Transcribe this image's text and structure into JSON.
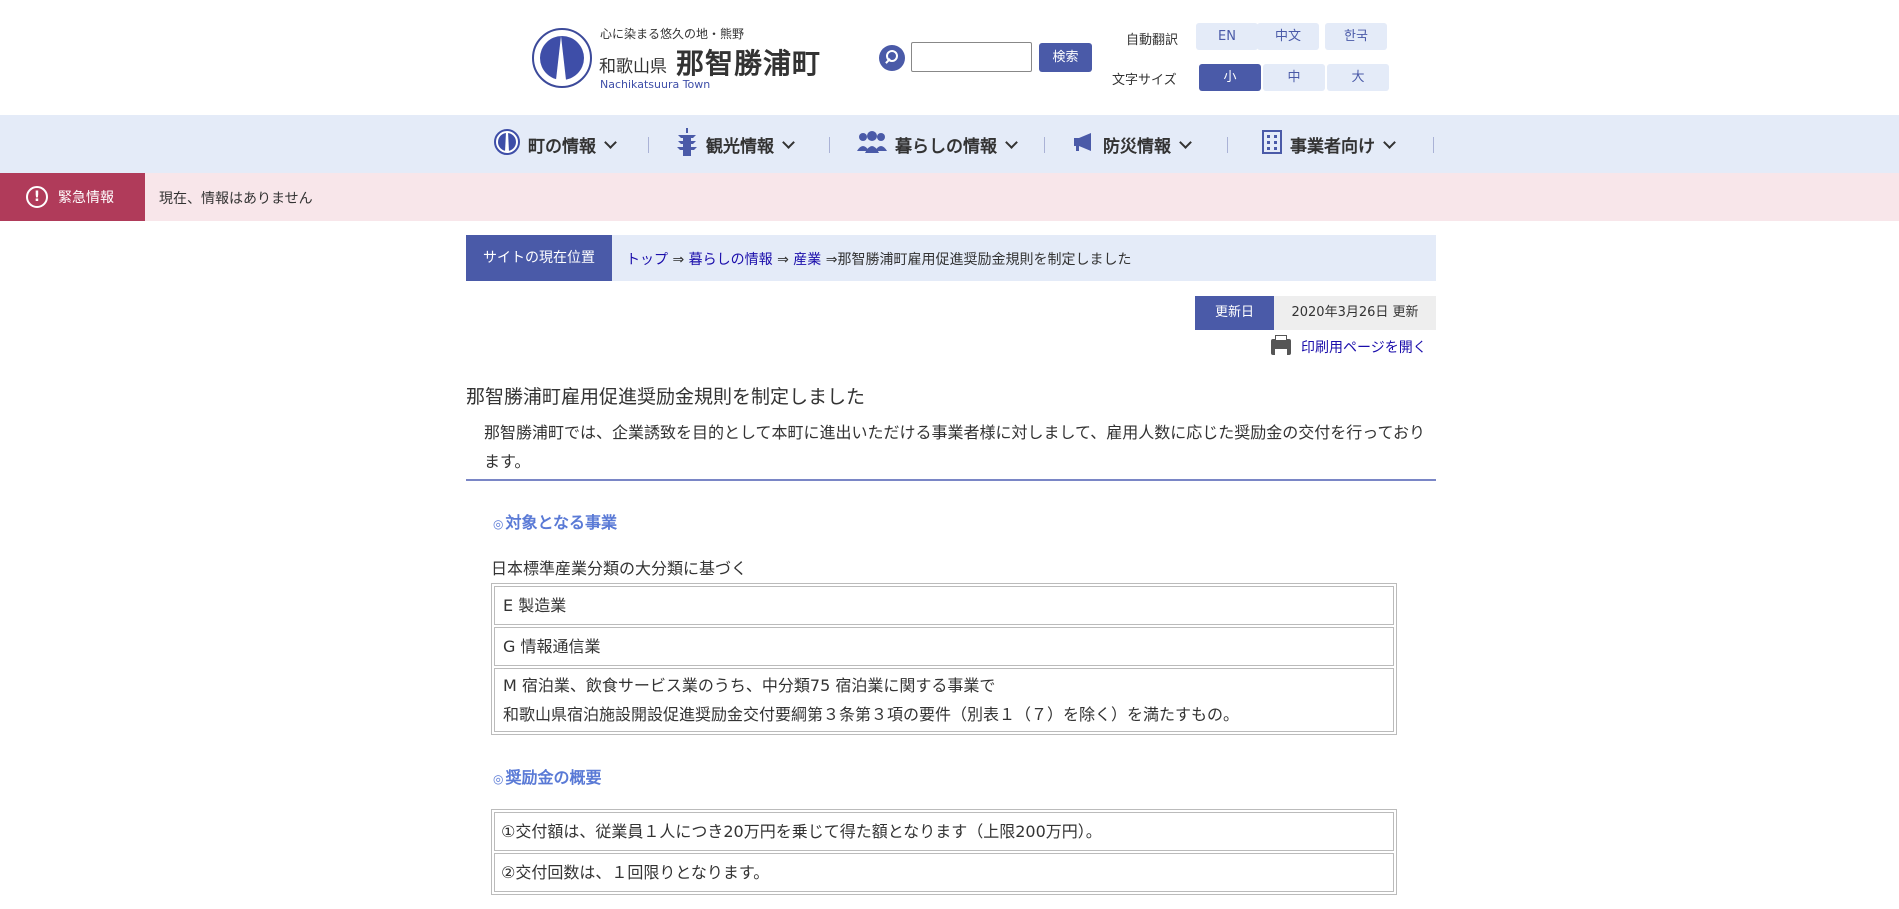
{
  "header": {
    "tagline": "心に染まる悠久の地・熊野",
    "prefecture": "和歌山県",
    "town_name": "那智勝浦町",
    "town_en": "Nachikatsuura Town",
    "search_button": "検索",
    "search_placeholder": "",
    "translate_label": "自動翻訳",
    "languages": [
      "EN",
      "中文",
      "한국"
    ],
    "font_size_label": "文字サイズ",
    "font_sizes": [
      "小",
      "中",
      "大"
    ],
    "font_size_selected": "小"
  },
  "nav": {
    "items": [
      {
        "label": "町の情報",
        "icon": "town-icon"
      },
      {
        "label": "観光情報",
        "icon": "pagoda-icon"
      },
      {
        "label": "暮らしの情報",
        "icon": "people-icon"
      },
      {
        "label": "防災情報",
        "icon": "megaphone-icon"
      },
      {
        "label": "事業者向け",
        "icon": "building-icon"
      }
    ]
  },
  "emergency": {
    "label": "緊急情報",
    "text": "現在、情報はありません"
  },
  "breadcrumb": {
    "label": "サイトの現在位置",
    "links": [
      "トップ",
      "暮らしの情報",
      "産業"
    ],
    "separator": "⇒",
    "current": "那智勝浦町雇用促進奨励金規則を制定しました"
  },
  "updated": {
    "label": "更新日",
    "value": "2020年3月26日 更新"
  },
  "print_link": "印刷用ページを開く",
  "content": {
    "title": "那智勝浦町雇用促進奨励金規則を制定しました",
    "lead": "那智勝浦町では、企業誘致を目的として本町に進出いただける事業者様に対しまして、雇用人数に応じた奨励金の交付を行っております。",
    "section1_mark": "◎",
    "section1_heading": "対象となる事業",
    "section1_basis": "日本標準産業分類の大分類に基づく",
    "section1_rows": [
      "E 製造業",
      "G 情報通信業",
      "M 宿泊業、飲食サービス業のうち、中分類75 宿泊業に関する事業で",
      "和歌山県宿泊施設開設促進奨励金交付要綱第３条第３項の要件（別表１（７）を除く）を満たすもの。"
    ],
    "section2_mark": "◎",
    "section2_heading": "奨励金の概要",
    "section2_rows": [
      "①交付額は、従業員１人につき20万円を乗じて得た額となります（上限200万円）。",
      "②交付回数は、１回限りとなります。"
    ]
  }
}
